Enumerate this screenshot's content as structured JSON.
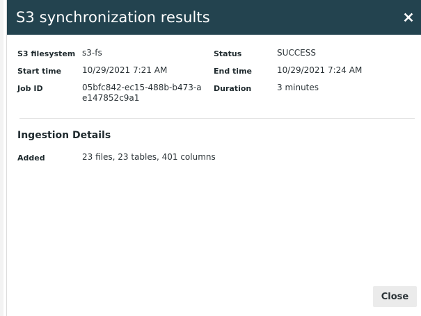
{
  "dialog": {
    "title": "S3 synchronization results",
    "close_icon": "close-icon"
  },
  "details": {
    "s3_filesystem_label": "S3 filesystem",
    "s3_filesystem_value": "s3-fs",
    "status_label": "Status",
    "status_value": "SUCCESS",
    "start_time_label": "Start time",
    "start_time_value": "10/29/2021 7:21 AM",
    "end_time_label": "End time",
    "end_time_value": "10/29/2021 7:24 AM",
    "job_id_label": "Job ID",
    "job_id_value": "05bfc842-ec15-488b-b473-ae147852c9a1",
    "duration_label": "Duration",
    "duration_value": "3 minutes"
  },
  "ingestion": {
    "title": "Ingestion Details",
    "added_label": "Added",
    "added_value": "23 files, 23 tables, 401 columns"
  },
  "footer": {
    "close_label": "Close"
  },
  "colors": {
    "header_bg": "#23434f",
    "header_text": "#ffffff",
    "button_bg": "#ebebeb"
  }
}
